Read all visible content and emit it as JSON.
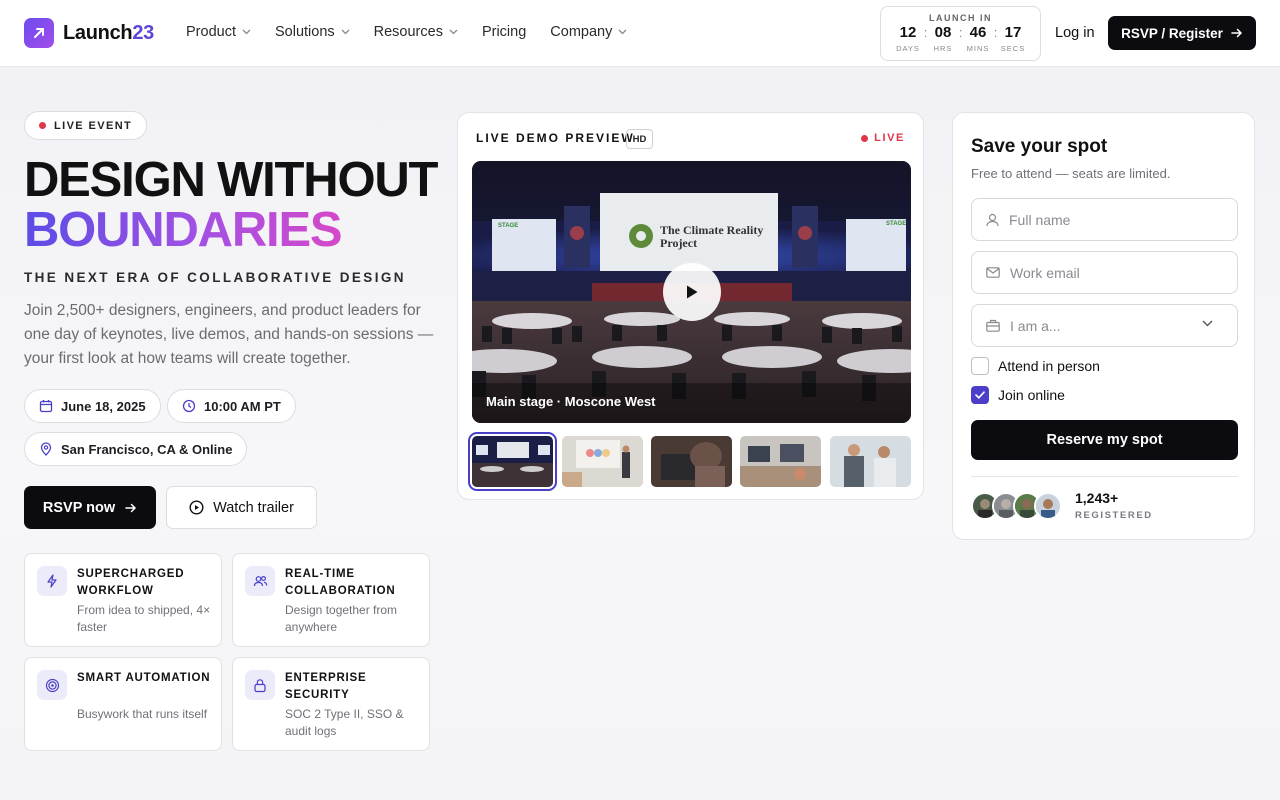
{
  "brand": {
    "name_main": "Launch",
    "name_accent": "23",
    "logo_icon": "arrow-up-right-icon",
    "accent_color": "#5b47d6"
  },
  "nav": {
    "items": [
      {
        "label": "Product",
        "has_menu": true
      },
      {
        "label": "Solutions",
        "has_menu": true
      },
      {
        "label": "Resources",
        "has_menu": true
      },
      {
        "label": "Pricing",
        "has_menu": false
      },
      {
        "label": "Company",
        "has_menu": true
      }
    ]
  },
  "countdown": {
    "label": "LAUNCH IN",
    "units": [
      {
        "value": "12",
        "caption": "DAYS"
      },
      {
        "value": "08",
        "caption": "HRS"
      },
      {
        "value": "46",
        "caption": "MINS"
      },
      {
        "value": "17",
        "caption": "SECS"
      }
    ]
  },
  "header": {
    "login_label": "Log in",
    "rsvp_label": "RSVP / Register"
  },
  "hero": {
    "badge": "LIVE EVENT",
    "headline_line1": "DESIGN WITHOUT",
    "headline_line2": "BOUNDARIES",
    "subtitle": "THE NEXT ERA OF COLLABORATIVE DESIGN",
    "intro": "Join 2,500+ designers, engineers, and product leaders for one day of keynotes, live demos, and hands-on sessions — your first look at how teams will create together.",
    "date": "June 18, 2025",
    "time": "10:00 AM PT",
    "location": "San Francisco, CA & Online",
    "rsvp_button": "RSVP now",
    "trailer_button": "Watch trailer"
  },
  "features": [
    {
      "title": "SUPERCHARGED WORKFLOW",
      "desc": "From idea to shipped, 4× faster",
      "icon": "lightning-icon"
    },
    {
      "title": "REAL-TIME COLLABORATION",
      "desc": "Design together from anywhere",
      "icon": "users-icon"
    },
    {
      "title": "SMART AUTOMATION",
      "desc": "Busywork that runs itself",
      "icon": "target-icon"
    },
    {
      "title": "ENTERPRISE SECURITY",
      "desc": "SOC 2 Type II, SSO & audit logs",
      "icon": "lock-icon"
    }
  ],
  "video": {
    "title": "LIVE DEMO PREVIEW",
    "quality": "HD",
    "live_label": "LIVE",
    "caption": "Main stage · Moscone West",
    "screen_text": "The Climate Reality Project",
    "stage_label": "STAGE",
    "thumbnails_count": 5,
    "active_thumbnail": 1
  },
  "form": {
    "title": "Save your spot",
    "subtitle": "Free to attend — seats are limited.",
    "name_placeholder": "Full name",
    "email_placeholder": "Work email",
    "role_placeholder": "I am a...",
    "attend_in_person": {
      "label": "Attend in person",
      "checked": false
    },
    "join_online": {
      "label": "Join online",
      "checked": true
    },
    "submit_label": "Reserve my spot",
    "registered_count": "1,243+",
    "registered_label": "REGISTERED"
  }
}
